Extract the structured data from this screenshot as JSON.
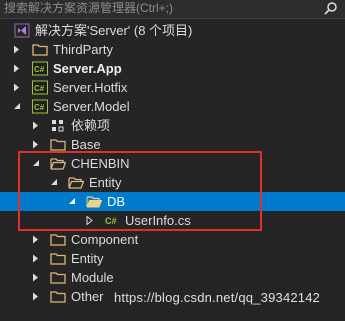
{
  "search": {
    "placeholder": "搜索解决方案资源管理器(Ctrl+;)"
  },
  "tree": {
    "solution": "解决方案'Server' (8 个项目)",
    "third_party": "ThirdParty",
    "server_app": "Server.App",
    "server_hotfix": "Server.Hotfix",
    "server_model": "Server.Model",
    "dependencies": "依赖项",
    "base": "Base",
    "chenbin": "CHENBIN",
    "entity_inner": "Entity",
    "db": "DB",
    "userinfo": "UserInfo.cs",
    "component": "Component",
    "entity": "Entity",
    "module": "Module",
    "other": "Other"
  },
  "watermark": "https://blog.csdn.net/qq_39342142",
  "colors": {
    "background": "#252526",
    "selection": "#007acc",
    "highlight_border": "#e0302c",
    "folder": "#dcb67a",
    "csharp_project": "#9bc53d",
    "solution_icon": "#68217a"
  }
}
